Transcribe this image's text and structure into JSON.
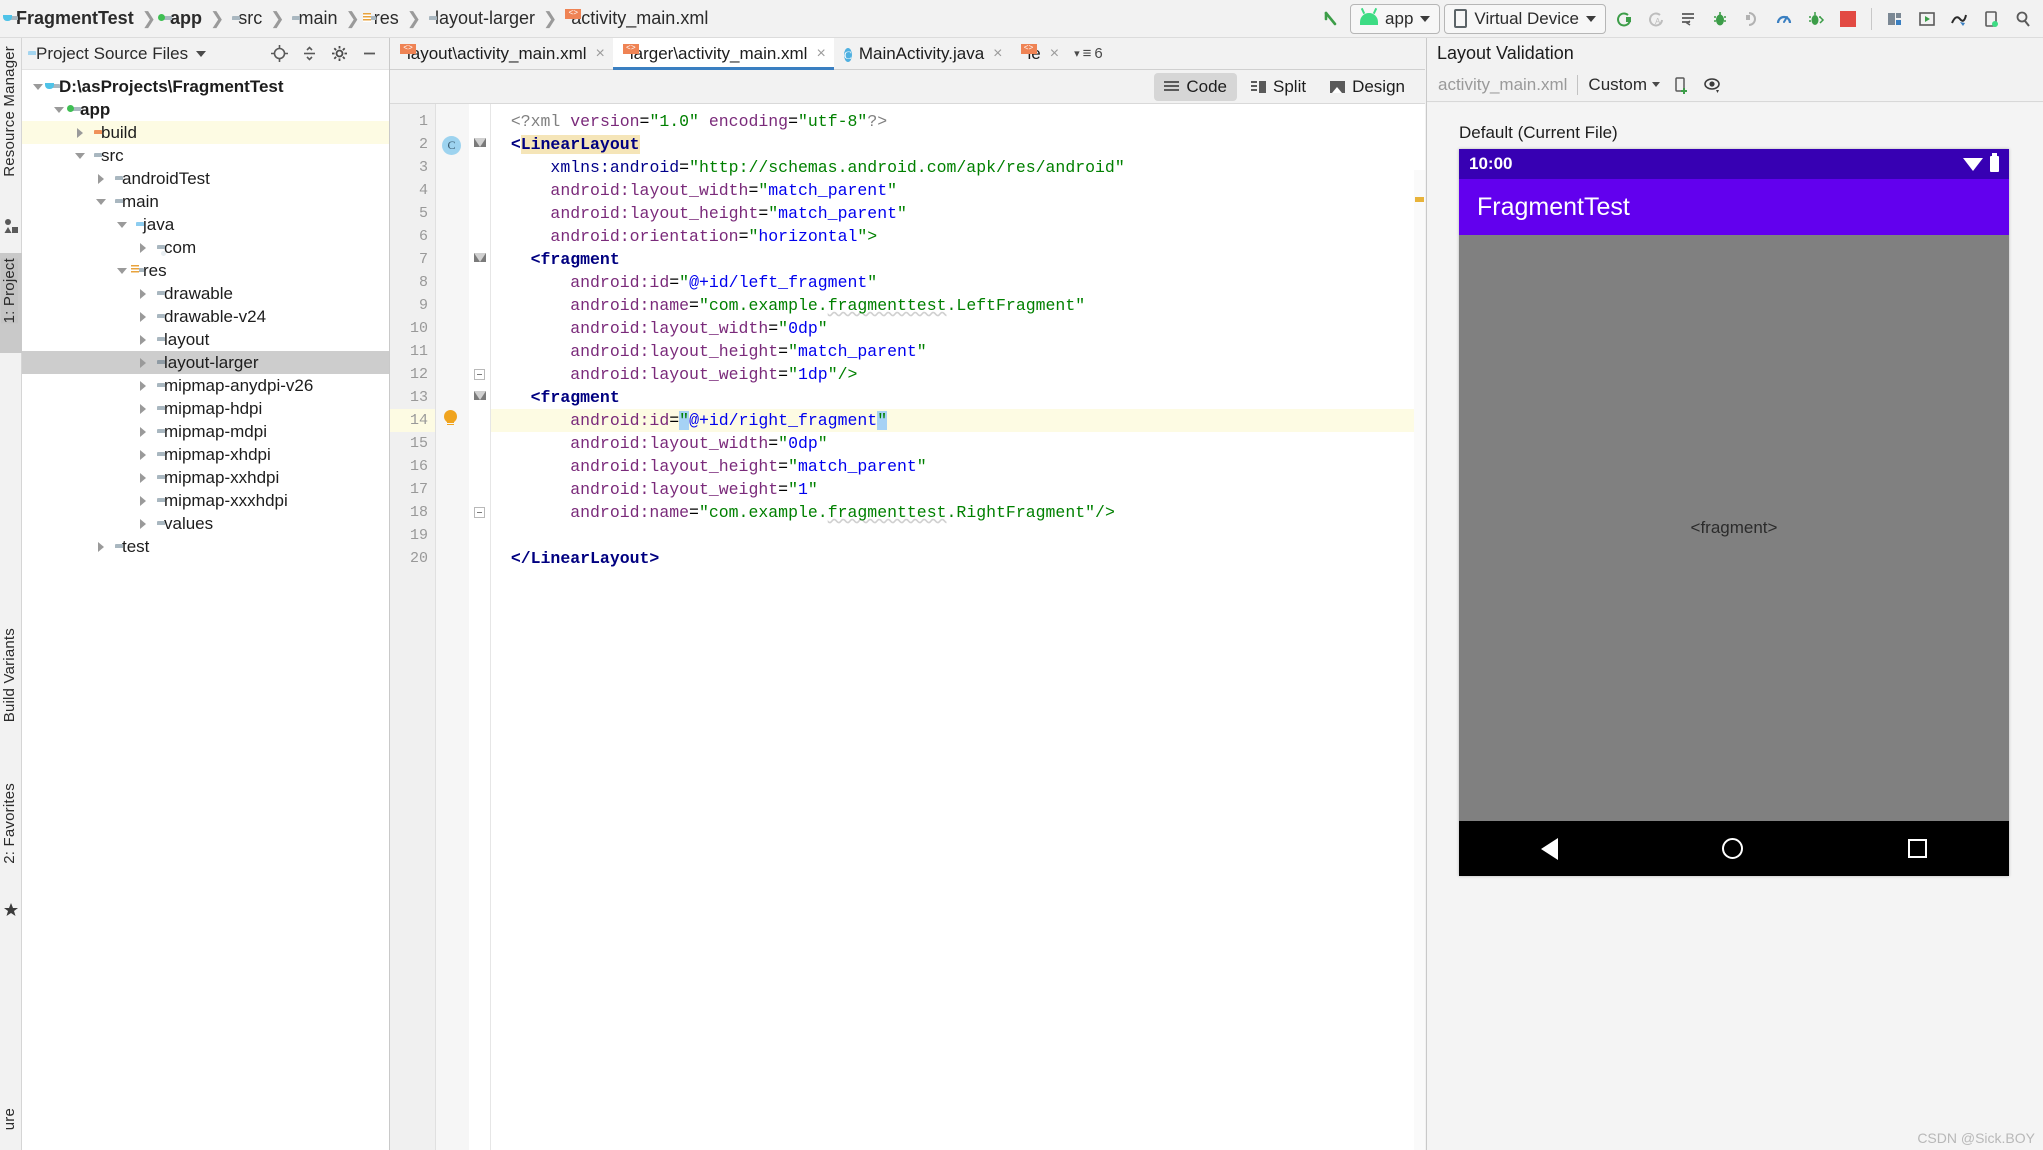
{
  "breadcrumb": [
    {
      "label": "FragmentTest",
      "icon": "project-folder-icon",
      "bold": true
    },
    {
      "label": "app",
      "icon": "module-folder-icon",
      "bold": true
    },
    {
      "label": "src",
      "icon": "folder-icon",
      "bold": false
    },
    {
      "label": "main",
      "icon": "folder-icon",
      "bold": false
    },
    {
      "label": "res",
      "icon": "res-folder-icon",
      "bold": false
    },
    {
      "label": "layout-larger",
      "icon": "folder-icon",
      "bold": false
    },
    {
      "label": "activity_main.xml",
      "icon": "xml-file-icon",
      "bold": false
    }
  ],
  "toolbar": {
    "build_icon": "hammer-icon",
    "run_config": "app",
    "device": "Virtual Device",
    "actions": [
      {
        "name": "run-button",
        "glyph": "⟳"
      },
      {
        "name": "rerun-button",
        "glyph": "⟳"
      },
      {
        "name": "apply-changes-button",
        "glyph": "≡"
      },
      {
        "name": "debug-button",
        "glyph": "🐞"
      },
      {
        "name": "attach-debugger-button",
        "glyph": "↺"
      },
      {
        "name": "profiler-button",
        "glyph": "◔"
      },
      {
        "name": "step-button",
        "glyph": "🐞"
      },
      {
        "name": "stop-button",
        "glyph": "■"
      }
    ],
    "right_actions": [
      {
        "name": "sdk-manager-icon",
        "glyph": "▤"
      },
      {
        "name": "avd-manager-icon",
        "glyph": "▷"
      },
      {
        "name": "layout-inspector-icon",
        "glyph": "✎"
      },
      {
        "name": "device-manager-icon",
        "glyph": "▯"
      },
      {
        "name": "search-icon",
        "glyph": "⚲"
      }
    ]
  },
  "left_strip": {
    "tabs": [
      {
        "label": "Resource Manager",
        "selected": false
      },
      {
        "label": "1: Project",
        "selected": true
      },
      {
        "label": "Build Variants",
        "selected": false
      },
      {
        "label": "2: Favorites",
        "selected": false
      },
      {
        "label": "ure",
        "selected": false
      }
    ]
  },
  "project": {
    "header_title": "Project Source Files",
    "header_icons": [
      "locate-icon",
      "collapse-all-icon",
      "settings-gear-icon",
      "hide-icon"
    ],
    "tree": [
      {
        "label": "D:\\asProjects\\FragmentTest",
        "depth": 0,
        "twisty": "down",
        "icon": "project-folder-icon",
        "bold": true,
        "hl": ""
      },
      {
        "label": "app",
        "depth": 1,
        "twisty": "down",
        "icon": "module-folder-icon",
        "bold": true,
        "hl": ""
      },
      {
        "label": "build",
        "depth": 2,
        "twisty": "right",
        "icon": "folder-orange-icon",
        "bold": false,
        "hl": "yellow"
      },
      {
        "label": "src",
        "depth": 2,
        "twisty": "down",
        "icon": "folder-icon",
        "bold": false,
        "hl": ""
      },
      {
        "label": "androidTest",
        "depth": 3,
        "twisty": "right",
        "icon": "folder-icon",
        "bold": false,
        "hl": ""
      },
      {
        "label": "main",
        "depth": 3,
        "twisty": "down",
        "icon": "folder-icon",
        "bold": false,
        "hl": ""
      },
      {
        "label": "java",
        "depth": 4,
        "twisty": "down",
        "icon": "folder-java-icon",
        "bold": false,
        "hl": ""
      },
      {
        "label": "com",
        "depth": 5,
        "twisty": "right",
        "icon": "folder-package-icon",
        "bold": false,
        "hl": ""
      },
      {
        "label": "res",
        "depth": 4,
        "twisty": "down",
        "icon": "res-folder-icon",
        "bold": false,
        "hl": ""
      },
      {
        "label": "drawable",
        "depth": 5,
        "twisty": "right",
        "icon": "folder-icon",
        "bold": false,
        "hl": ""
      },
      {
        "label": "drawable-v24",
        "depth": 5,
        "twisty": "right",
        "icon": "folder-icon",
        "bold": false,
        "hl": ""
      },
      {
        "label": "layout",
        "depth": 5,
        "twisty": "right",
        "icon": "folder-icon",
        "bold": false,
        "hl": ""
      },
      {
        "label": "layout-larger",
        "depth": 5,
        "twisty": "right",
        "icon": "folder-dark-icon",
        "bold": false,
        "hl": "grey"
      },
      {
        "label": "mipmap-anydpi-v26",
        "depth": 5,
        "twisty": "right",
        "icon": "folder-icon",
        "bold": false,
        "hl": ""
      },
      {
        "label": "mipmap-hdpi",
        "depth": 5,
        "twisty": "right",
        "icon": "folder-icon",
        "bold": false,
        "hl": ""
      },
      {
        "label": "mipmap-mdpi",
        "depth": 5,
        "twisty": "right",
        "icon": "folder-icon",
        "bold": false,
        "hl": ""
      },
      {
        "label": "mipmap-xhdpi",
        "depth": 5,
        "twisty": "right",
        "icon": "folder-icon",
        "bold": false,
        "hl": ""
      },
      {
        "label": "mipmap-xxhdpi",
        "depth": 5,
        "twisty": "right",
        "icon": "folder-icon",
        "bold": false,
        "hl": ""
      },
      {
        "label": "mipmap-xxxhdpi",
        "depth": 5,
        "twisty": "right",
        "icon": "folder-icon",
        "bold": false,
        "hl": ""
      },
      {
        "label": "values",
        "depth": 5,
        "twisty": "right",
        "icon": "folder-icon",
        "bold": false,
        "hl": ""
      },
      {
        "label": "test",
        "depth": 3,
        "twisty": "right",
        "icon": "folder-icon",
        "bold": false,
        "hl": ""
      }
    ]
  },
  "editor": {
    "tabs": [
      {
        "label": "layout\\activity_main.xml",
        "icon": "xml-file-icon",
        "active": false,
        "close": "×"
      },
      {
        "label": "larger\\activity_main.xml",
        "icon": "xml-file-icon",
        "active": true,
        "close": "×"
      },
      {
        "label": "MainActivity.java",
        "icon": "java-class-icon",
        "active": false,
        "close": "×"
      },
      {
        "label": "le",
        "icon": "xml-file-icon",
        "active": false,
        "close": "×"
      }
    ],
    "tab_overflow_count": "6",
    "modes": [
      {
        "label": "Code",
        "selected": true
      },
      {
        "label": "Split",
        "selected": false
      },
      {
        "label": "Design",
        "selected": false
      }
    ],
    "line_numbers": [
      "1",
      "2",
      "3",
      "4",
      "5",
      "6",
      "7",
      "8",
      "9",
      "10",
      "11",
      "12",
      "13",
      "14",
      "15",
      "16",
      "17",
      "18",
      "19",
      "20"
    ],
    "code_lines": [
      {
        "n": 1,
        "indent": 0,
        "highlight": false,
        "tokens": [
          {
            "t": "<?xml ",
            "c": "tok-grey"
          },
          {
            "t": "version",
            "c": "tok-attr"
          },
          {
            "t": "=",
            "c": "tok-punct"
          },
          {
            "t": "\"1.0\"",
            "c": "tok-str"
          },
          {
            "t": " ",
            "c": "tok-punct"
          },
          {
            "t": "encoding",
            "c": "tok-attr"
          },
          {
            "t": "=",
            "c": "tok-punct"
          },
          {
            "t": "\"utf-8\"",
            "c": "tok-str"
          },
          {
            "t": "?>",
            "c": "tok-grey"
          }
        ]
      },
      {
        "n": 2,
        "indent": 0,
        "highlight": false,
        "tokens": [
          {
            "t": "<",
            "c": "tok-tag"
          },
          {
            "t": "LinearLayout",
            "c": "tok-tag chip-yellow"
          }
        ]
      },
      {
        "n": 3,
        "indent": 2,
        "highlight": false,
        "tokens": [
          {
            "t": "xmlns:android",
            "c": "tok-ns"
          },
          {
            "t": "=",
            "c": "tok-punct"
          },
          {
            "t": "\"http://schemas.android.com/apk/res/android\"",
            "c": "tok-str"
          }
        ]
      },
      {
        "n": 4,
        "indent": 2,
        "highlight": false,
        "tokens": [
          {
            "t": "android:layout_width",
            "c": "tok-attr"
          },
          {
            "t": "=",
            "c": "tok-punct"
          },
          {
            "t": "\"",
            "c": "tok-str"
          },
          {
            "t": "match_parent",
            "c": "tok-val"
          },
          {
            "t": "\"",
            "c": "tok-str"
          }
        ]
      },
      {
        "n": 5,
        "indent": 2,
        "highlight": false,
        "tokens": [
          {
            "t": "android:layout_height",
            "c": "tok-attr"
          },
          {
            "t": "=",
            "c": "tok-punct"
          },
          {
            "t": "\"",
            "c": "tok-str"
          },
          {
            "t": "match_parent",
            "c": "tok-val"
          },
          {
            "t": "\"",
            "c": "tok-str"
          }
        ]
      },
      {
        "n": 6,
        "indent": 2,
        "highlight": false,
        "tokens": [
          {
            "t": "android:orientation",
            "c": "tok-attr"
          },
          {
            "t": "=",
            "c": "tok-punct"
          },
          {
            "t": "\"",
            "c": "tok-str"
          },
          {
            "t": "horizontal",
            "c": "tok-val"
          },
          {
            "t": "\">",
            "c": "tok-str"
          }
        ]
      },
      {
        "n": 7,
        "indent": 1,
        "highlight": false,
        "tokens": [
          {
            "t": "<fragment",
            "c": "tok-tag"
          }
        ]
      },
      {
        "n": 8,
        "indent": 3,
        "highlight": false,
        "tokens": [
          {
            "t": "android:id",
            "c": "tok-attr"
          },
          {
            "t": "=",
            "c": "tok-punct"
          },
          {
            "t": "\"",
            "c": "tok-str"
          },
          {
            "t": "@+id/left_fragment",
            "c": "tok-val"
          },
          {
            "t": "\"",
            "c": "tok-str"
          }
        ]
      },
      {
        "n": 9,
        "indent": 3,
        "highlight": false,
        "tokens": [
          {
            "t": "android:name",
            "c": "tok-attr"
          },
          {
            "t": "=",
            "c": "tok-punct"
          },
          {
            "t": "\"com.example.",
            "c": "tok-str"
          },
          {
            "t": "fragmenttest",
            "c": "tok-str tok-squig"
          },
          {
            "t": ".LeftFragment\"",
            "c": "tok-str"
          }
        ]
      },
      {
        "n": 10,
        "indent": 3,
        "highlight": false,
        "tokens": [
          {
            "t": "android:layout_width",
            "c": "tok-attr"
          },
          {
            "t": "=",
            "c": "tok-punct"
          },
          {
            "t": "\"",
            "c": "tok-str"
          },
          {
            "t": "0dp",
            "c": "tok-val"
          },
          {
            "t": "\"",
            "c": "tok-str"
          }
        ]
      },
      {
        "n": 11,
        "indent": 3,
        "highlight": false,
        "tokens": [
          {
            "t": "android:layout_height",
            "c": "tok-attr"
          },
          {
            "t": "=",
            "c": "tok-punct"
          },
          {
            "t": "\"",
            "c": "tok-str"
          },
          {
            "t": "match_parent",
            "c": "tok-val"
          },
          {
            "t": "\"",
            "c": "tok-str"
          }
        ]
      },
      {
        "n": 12,
        "indent": 3,
        "highlight": false,
        "tokens": [
          {
            "t": "android:layout_weight",
            "c": "tok-attr"
          },
          {
            "t": "=",
            "c": "tok-punct"
          },
          {
            "t": "\"",
            "c": "tok-str"
          },
          {
            "t": "1dp",
            "c": "tok-val"
          },
          {
            "t": "\"/>",
            "c": "tok-str"
          }
        ]
      },
      {
        "n": 13,
        "indent": 1,
        "highlight": false,
        "tokens": [
          {
            "t": "<fragment",
            "c": "tok-tag"
          }
        ]
      },
      {
        "n": 14,
        "indent": 3,
        "highlight": true,
        "tokens": [
          {
            "t": "android:id",
            "c": "tok-attr"
          },
          {
            "t": "=",
            "c": "tok-punct"
          },
          {
            "t": "\"",
            "c": "tok-str sel-blue"
          },
          {
            "t": "@+id/right_fragment",
            "c": "tok-val"
          },
          {
            "t": "\"",
            "c": "tok-str sel-blue"
          }
        ]
      },
      {
        "n": 15,
        "indent": 3,
        "highlight": false,
        "tokens": [
          {
            "t": "android:layout_width",
            "c": "tok-attr"
          },
          {
            "t": "=",
            "c": "tok-punct"
          },
          {
            "t": "\"",
            "c": "tok-str"
          },
          {
            "t": "0dp",
            "c": "tok-val"
          },
          {
            "t": "\"",
            "c": "tok-str"
          }
        ]
      },
      {
        "n": 16,
        "indent": 3,
        "highlight": false,
        "tokens": [
          {
            "t": "android:layout_height",
            "c": "tok-attr"
          },
          {
            "t": "=",
            "c": "tok-punct"
          },
          {
            "t": "\"",
            "c": "tok-str"
          },
          {
            "t": "match_parent",
            "c": "tok-val"
          },
          {
            "t": "\"",
            "c": "tok-str"
          }
        ]
      },
      {
        "n": 17,
        "indent": 3,
        "highlight": false,
        "tokens": [
          {
            "t": "android:layout_weight",
            "c": "tok-attr"
          },
          {
            "t": "=",
            "c": "tok-punct"
          },
          {
            "t": "\"",
            "c": "tok-str"
          },
          {
            "t": "1",
            "c": "tok-val"
          },
          {
            "t": "\"",
            "c": "tok-str"
          }
        ]
      },
      {
        "n": 18,
        "indent": 3,
        "highlight": false,
        "tokens": [
          {
            "t": "android:name",
            "c": "tok-attr"
          },
          {
            "t": "=",
            "c": "tok-punct"
          },
          {
            "t": "\"com.example.",
            "c": "tok-str"
          },
          {
            "t": "fragmenttest",
            "c": "tok-str tok-squig"
          },
          {
            "t": ".RightFragment\"/>",
            "c": "tok-str"
          }
        ]
      },
      {
        "n": 19,
        "indent": 0,
        "highlight": false,
        "tokens": []
      },
      {
        "n": 20,
        "indent": 0,
        "highlight": false,
        "tokens": [
          {
            "t": "</LinearLayout>",
            "c": "tok-tag"
          }
        ]
      }
    ],
    "gutter_markers": [
      {
        "line": 2,
        "type": "class-marker",
        "label": "C"
      },
      {
        "line": 14,
        "type": "intention-bulb-icon",
        "label": ""
      }
    ]
  },
  "validation": {
    "title": "Layout Validation",
    "file_name": "activity_main.xml",
    "config": "Custom",
    "icons": [
      "add-device-icon",
      "visibility-icon"
    ],
    "preview_label": "Default (Current File)",
    "device": {
      "status_time": "10:00",
      "app_title": "FragmentTest",
      "content_text": "<fragment>",
      "nav": [
        "back-button",
        "home-button",
        "recents-button"
      ]
    },
    "watermark": "CSDN @Sick.BOY"
  },
  "colors": {
    "accent_blue": "#3a7fc1",
    "android_green": "#3ddc84",
    "appbar_purple": "#6200ee",
    "statusbar_purple": "#3700b3",
    "highlight_yellow": "#fdfbe3",
    "selection_blue": "#a6d2f5"
  }
}
